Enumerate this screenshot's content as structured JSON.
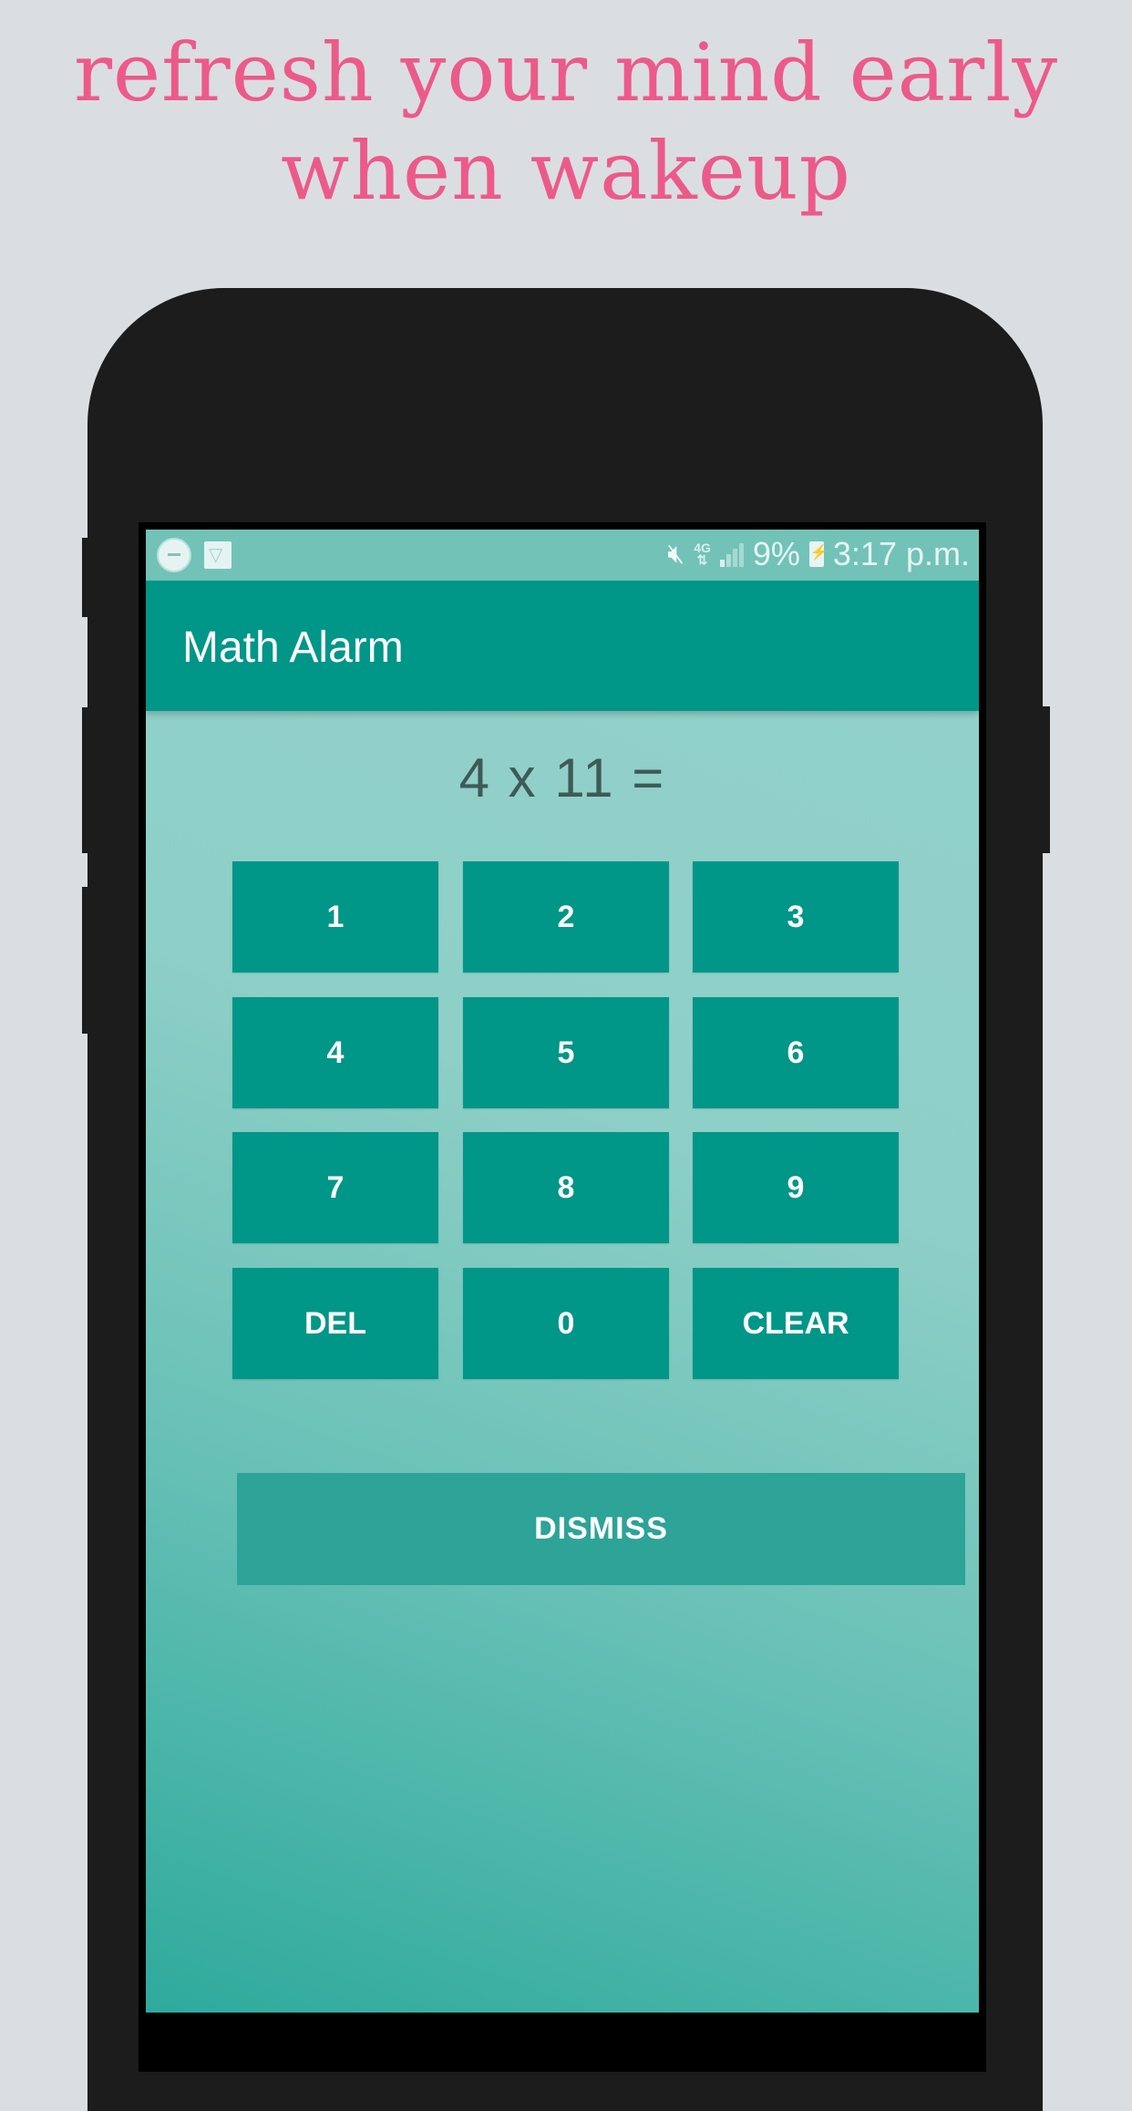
{
  "promo": {
    "headline_line1": "refresh your mind early",
    "headline_line2": "when wakeup",
    "headline_color": "#ec5a8a"
  },
  "status_bar": {
    "left_icons": [
      "alarm-clock-icon",
      "email-notification-icon"
    ],
    "right_icons": [
      "mute-icon",
      "4g-lte-icon",
      "signal-icon",
      "battery-charging-icon"
    ],
    "network_label": "4G",
    "battery_percent": "9%",
    "time": "3:17 p.m."
  },
  "app_bar": {
    "title": "Math Alarm",
    "color": "#009688"
  },
  "problem": {
    "question": "4 x 11 ="
  },
  "keypad": {
    "keys": [
      {
        "label": "1"
      },
      {
        "label": "2"
      },
      {
        "label": "3"
      },
      {
        "label": "4"
      },
      {
        "label": "5"
      },
      {
        "label": "6"
      },
      {
        "label": "7"
      },
      {
        "label": "8"
      },
      {
        "label": "9"
      },
      {
        "label": "DEL"
      },
      {
        "label": "0"
      },
      {
        "label": "CLEAR"
      }
    ]
  },
  "actions": {
    "dismiss_label": "DISMISS"
  }
}
